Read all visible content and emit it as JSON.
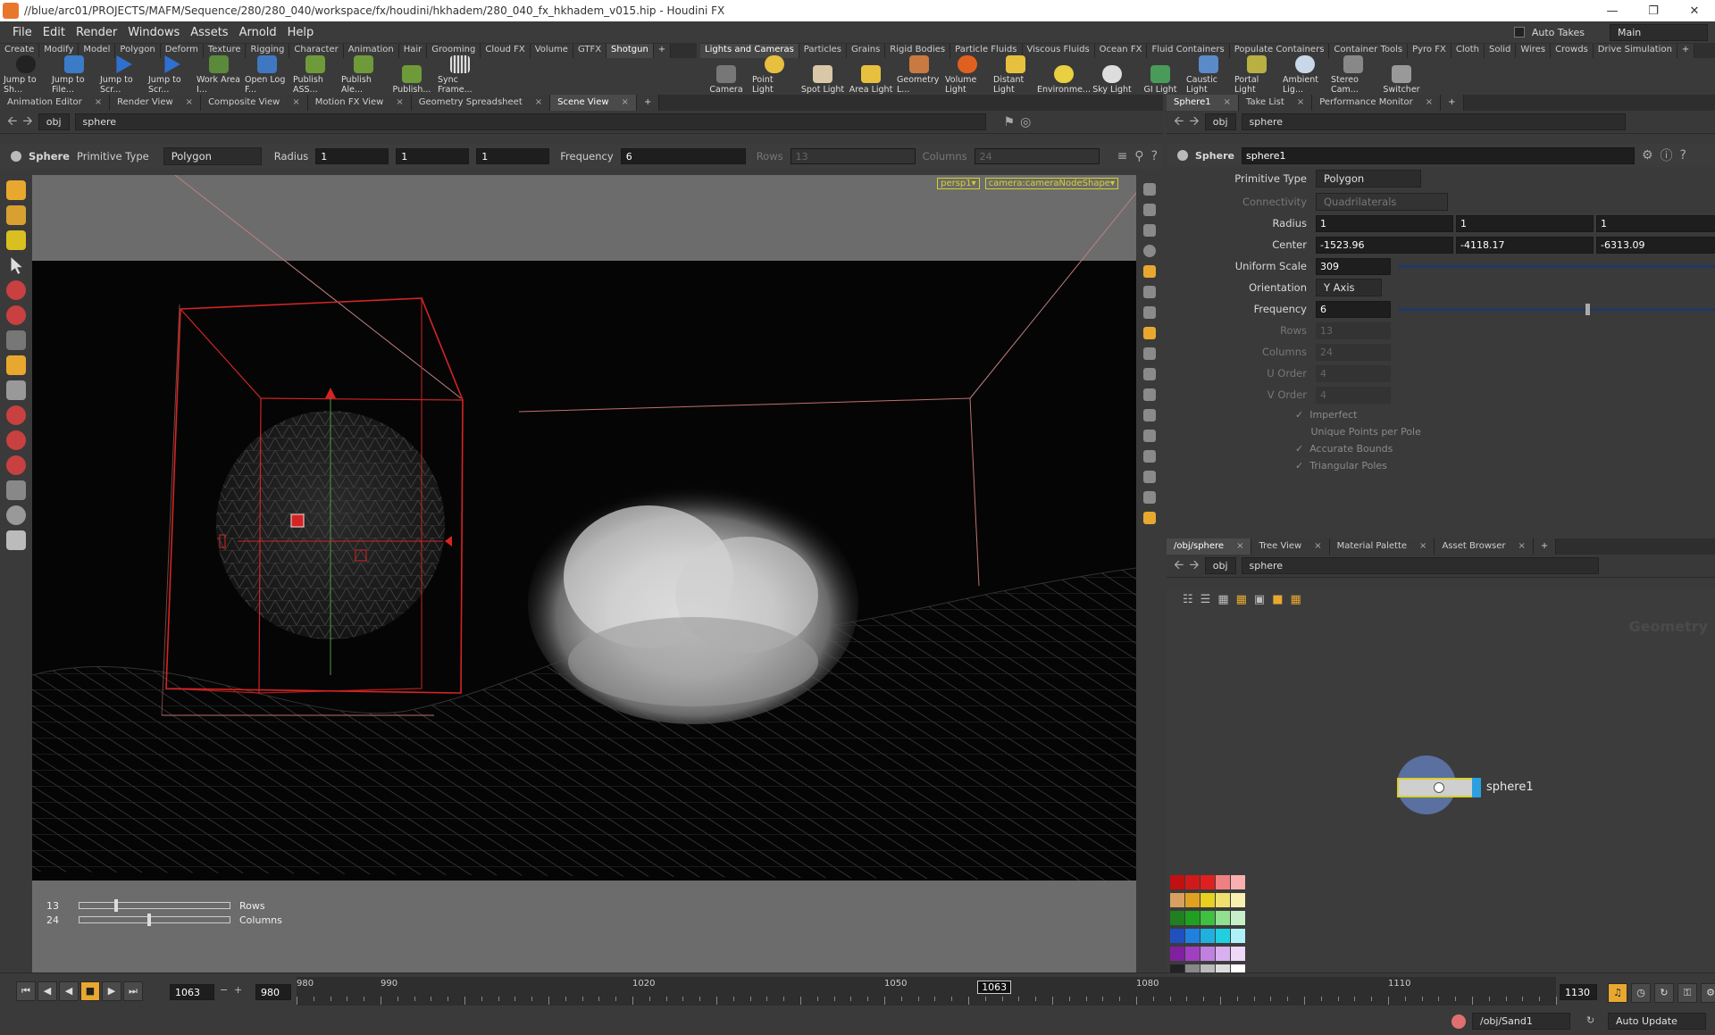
{
  "window": {
    "title": "//blue/arc01/PROJECTS/MAFM/Sequence/280/280_040/workspace/fx/houdini/hkhadem/280_040_fx_hkhadem_v015.hip - Houdini FX"
  },
  "menu": [
    "File",
    "Edit",
    "Render",
    "Windows",
    "Assets",
    "Arnold",
    "Help"
  ],
  "menu_right": {
    "auto_takes": "Auto Takes",
    "desktop": "Main"
  },
  "shelf_left": {
    "tabs": [
      "Create",
      "Modify",
      "Model",
      "Polygon",
      "Deform",
      "Texture",
      "Rigging",
      "Character",
      "Animation",
      "Hair",
      "Grooming",
      "Cloud FX",
      "Volume",
      "GTFX",
      "Shotgun"
    ],
    "active_tab": "Shotgun",
    "tools": [
      "Jump to Sh...",
      "Jump to File...",
      "Jump to Scr...",
      "Jump to Scr...",
      "Work Area I...",
      "Open Log F...",
      "Publish ASS...",
      "Publish Ale...",
      "Publish...",
      "Sync Frame..."
    ]
  },
  "shelf_right": {
    "tabs": [
      "Lights and Cameras",
      "Particles",
      "Grains",
      "Rigid Bodies",
      "Particle Fluids",
      "Viscous Fluids",
      "Ocean FX",
      "Fluid Containers",
      "Populate Containers",
      "Container Tools",
      "Pyro FX",
      "Cloth",
      "Solid",
      "Wires",
      "Crowds",
      "Drive Simulation"
    ],
    "active_tab": "Lights and Cameras",
    "tools": [
      "Camera",
      "Point Light",
      "Spot Light",
      "Area Light",
      "Geometry L...",
      "Volume Light",
      "Distant Light",
      "Environme...",
      "Sky Light",
      "GI Light",
      "Caustic Light",
      "Portal Light",
      "Ambient Lig...",
      "Stereo Cam...",
      "Switcher"
    ]
  },
  "left_pane": {
    "tabs": [
      "Animation Editor",
      "Render View",
      "Composite View",
      "Motion FX View",
      "Geometry Spreadsheet",
      "Scene View"
    ],
    "active_tab": "Scene View",
    "path": [
      "obj",
      "sphere"
    ],
    "operator_bar": {
      "node": "Sphere",
      "primitive_type_label": "Primitive Type",
      "primitive_type": "Polygon",
      "radius_label": "Radius",
      "radius": [
        "1",
        "1",
        "1"
      ],
      "frequency_label": "Frequency",
      "frequency": "6",
      "rows_label": "Rows",
      "rows": "13",
      "columns_label": "Columns",
      "columns": "24"
    },
    "viewport": {
      "camera_menu": "persp1",
      "camera_shape": "camera:cameraNodeShape",
      "handles": [
        {
          "value": "13",
          "label": "Rows",
          "level": 0.23
        },
        {
          "value": "24",
          "label": "Columns",
          "level": 0.45
        }
      ]
    }
  },
  "param_pane": {
    "tabs": [
      "Sphere1",
      "Take List",
      "Performance Monitor"
    ],
    "path": [
      "obj",
      "sphere"
    ],
    "node_type": "Sphere",
    "node_name": "sphere1",
    "params": {
      "primitive_type": {
        "label": "Primitive Type",
        "value": "Polygon"
      },
      "connectivity": {
        "label": "Connectivity",
        "value": "Quadrilaterals"
      },
      "radius": {
        "label": "Radius",
        "values": [
          "1",
          "1",
          "1"
        ]
      },
      "center": {
        "label": "Center",
        "values": [
          "-1523.96",
          "-4118.17",
          "-6313.09"
        ]
      },
      "uniform_scale": {
        "label": "Uniform Scale",
        "value": "309",
        "level": 0.99
      },
      "orientation": {
        "label": "Orientation",
        "value": "Y Axis"
      },
      "frequency": {
        "label": "Frequency",
        "value": "6",
        "level": 0.56
      },
      "rows": {
        "label": "Rows",
        "value": "13"
      },
      "columns": {
        "label": "Columns",
        "value": "24"
      },
      "u_order": {
        "label": "U Order",
        "value": "4"
      },
      "v_order": {
        "label": "V Order",
        "value": "4"
      }
    },
    "toggles": [
      "Imperfect",
      "Unique Points per Pole",
      "Accurate Bounds",
      "Triangular Poles"
    ]
  },
  "network_pane": {
    "tabs": [
      "/obj/sphere",
      "Tree View",
      "Material Palette",
      "Asset Browser"
    ],
    "path": [
      "obj",
      "sphere"
    ],
    "context_label": "Geometry",
    "node_label": "sphere1"
  },
  "playbar": {
    "current_frame": "1063",
    "start_frame": "980",
    "end_frame": "1130",
    "frame_marker": "1063",
    "ticks": [
      "980",
      "990",
      "1020",
      "1050",
      "1080",
      "1110"
    ]
  },
  "status": {
    "path": "/obj/Sand1",
    "update_mode": "Auto Update"
  },
  "colors": {
    "accent_red": "#d42424",
    "selection_yellow": "#d8d02a",
    "panel_bg": "#3a3a3a"
  }
}
